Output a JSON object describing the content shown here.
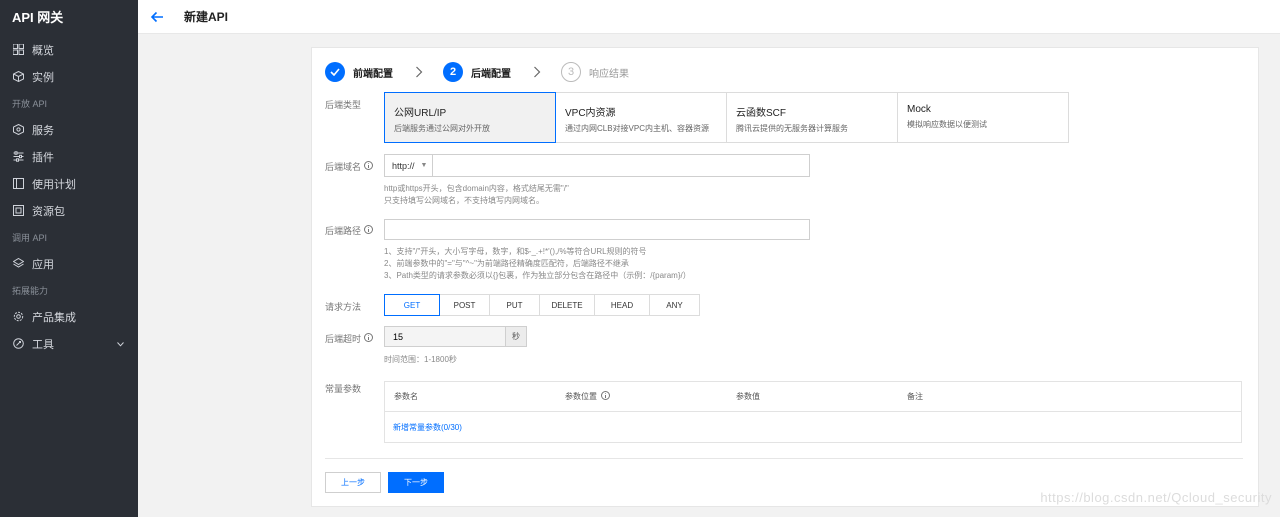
{
  "sidebar": {
    "brand": "API 网关",
    "groups": [
      {
        "section": "",
        "items": [
          {
            "label": "概览",
            "icon": "grid-icon"
          },
          {
            "label": "实例",
            "icon": "cube-icon"
          }
        ]
      },
      {
        "section": "开放 API",
        "items": [
          {
            "label": "服务",
            "icon": "service-icon"
          },
          {
            "label": "插件",
            "icon": "plugin-icon"
          },
          {
            "label": "使用计划",
            "icon": "plan-icon"
          },
          {
            "label": "资源包",
            "icon": "package-icon"
          }
        ]
      },
      {
        "section": "调用 API",
        "items": [
          {
            "label": "应用",
            "icon": "layers-icon"
          }
        ]
      },
      {
        "section": "拓展能力",
        "items": [
          {
            "label": "产品集成",
            "icon": "gear-icon"
          },
          {
            "label": "工具",
            "icon": "tool-icon"
          }
        ]
      }
    ]
  },
  "header": {
    "title": "新建API"
  },
  "steps": [
    {
      "number": "1",
      "label": "前端配置",
      "state": "done"
    },
    {
      "number": "2",
      "label": "后端配置",
      "state": "active"
    },
    {
      "number": "3",
      "label": "响应结果",
      "state": "todo"
    }
  ],
  "form": {
    "backend_type_label": "后端类型",
    "backend_types": [
      {
        "title": "公网URL/IP",
        "desc": "后端服务通过公网对外开放",
        "selected": true
      },
      {
        "title": "VPC内资源",
        "desc": "通过内网CLB对接VPC内主机、容器资源",
        "selected": false
      },
      {
        "title": "云函数SCF",
        "desc": "腾讯云提供的无服务器计算服务",
        "selected": false
      },
      {
        "title": "Mock",
        "desc": "模拟响应数据以便测试",
        "selected": false
      }
    ],
    "domain_label": "后端域名",
    "protocol": "http://",
    "domain_value": "",
    "domain_help": [
      "http或https开头，包含domain内容，格式结尾无需\"/\"",
      "只支持填写公网域名，不支持填写内网域名。"
    ],
    "path_label": "后端路径",
    "path_value": "",
    "path_help": [
      "1、支持\"/\"开头，大小写字母，数字，和$-_.+!*'(),/%等符合URL规则的符号",
      "2、前端参数中的\"=\"与\"^~\"为前端路径精确度匹配符，后端路径不继承",
      "3、Path类型的请求参数必须以{}包裹，作为独立部分包含在路径中（示例：/{param}/）"
    ],
    "method_label": "请求方法",
    "methods": [
      "GET",
      "POST",
      "PUT",
      "DELETE",
      "HEAD",
      "ANY"
    ],
    "selected_method": "GET",
    "timeout_label": "后端超时",
    "timeout_value": "15",
    "timeout_unit": "秒",
    "timeout_help": "时间范围：1-1800秒",
    "const_params_label": "常量参数",
    "const_params_columns": [
      "参数名",
      "参数位置",
      "参数值",
      "备注"
    ],
    "add_const_param": "新增常量参数(0/30)"
  },
  "footer": {
    "prev_label": "上一步",
    "next_label": "下一步"
  },
  "watermark": "https://blog.csdn.net/Qcloud_security",
  "colors": {
    "accent": "#006eff",
    "sidebar_bg": "#2b2f36"
  }
}
